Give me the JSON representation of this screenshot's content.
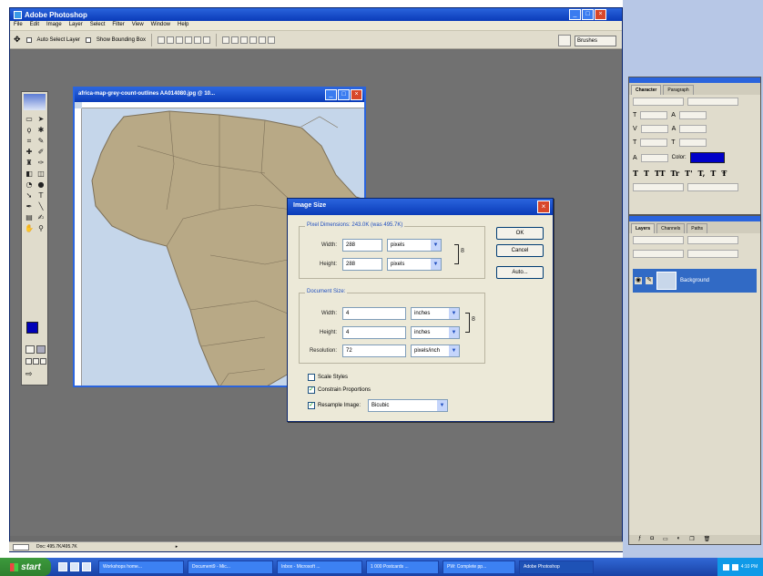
{
  "app": {
    "title": "Adobe Photoshop",
    "menu": [
      "File",
      "Edit",
      "Image",
      "Layer",
      "Select",
      "Filter",
      "View",
      "Window",
      "Help"
    ],
    "options": {
      "auto_select": "Auto Select Layer",
      "show_bounding": "Show Bounding Box",
      "brushes_tab": "Brushes"
    }
  },
  "document": {
    "title": "africa-map-grey-count-outlines AA014080.jpg @ 10..."
  },
  "dialog": {
    "title": "Image Size",
    "pixel_dimensions": {
      "label": "Pixel Dimensions: 243.0K (was 495.7K)",
      "width_label": "Width:",
      "width_value": "288",
      "width_unit": "pixels",
      "height_label": "Height:",
      "height_value": "288",
      "height_unit": "pixels"
    },
    "document_size": {
      "label": "Document Size:",
      "width_label": "Width:",
      "width_value": "4",
      "width_unit": "inches",
      "height_label": "Height:",
      "height_value": "4",
      "height_unit": "inches",
      "resolution_label": "Resolution:",
      "resolution_value": "72",
      "resolution_unit": "pixels/inch"
    },
    "buttons": {
      "ok": "OK",
      "cancel": "Cancel",
      "auto": "Auto..."
    },
    "options": {
      "scale_styles": "Scale Styles",
      "constrain": "Constrain Proportions",
      "resample": "Resample Image:",
      "resample_method": "Bicubic"
    }
  },
  "panels": {
    "character_tabs": [
      "Character",
      "Paragraph"
    ],
    "color_label": "Color:",
    "layers_tabs": [
      "Layers",
      "Channels",
      "Paths"
    ],
    "layer_name": "Background"
  },
  "status": {
    "doc": "Doc: 495.7K/495.7K"
  },
  "taskbar": {
    "start": "start",
    "items": [
      "Workshops home...",
      "Document9 - Mic...",
      "Inbox - Microsoft ...",
      "1 000 Postcards ...",
      "PW: Complete pp...",
      "Adobe Photoshop"
    ],
    "clock": "4:10 PM"
  }
}
